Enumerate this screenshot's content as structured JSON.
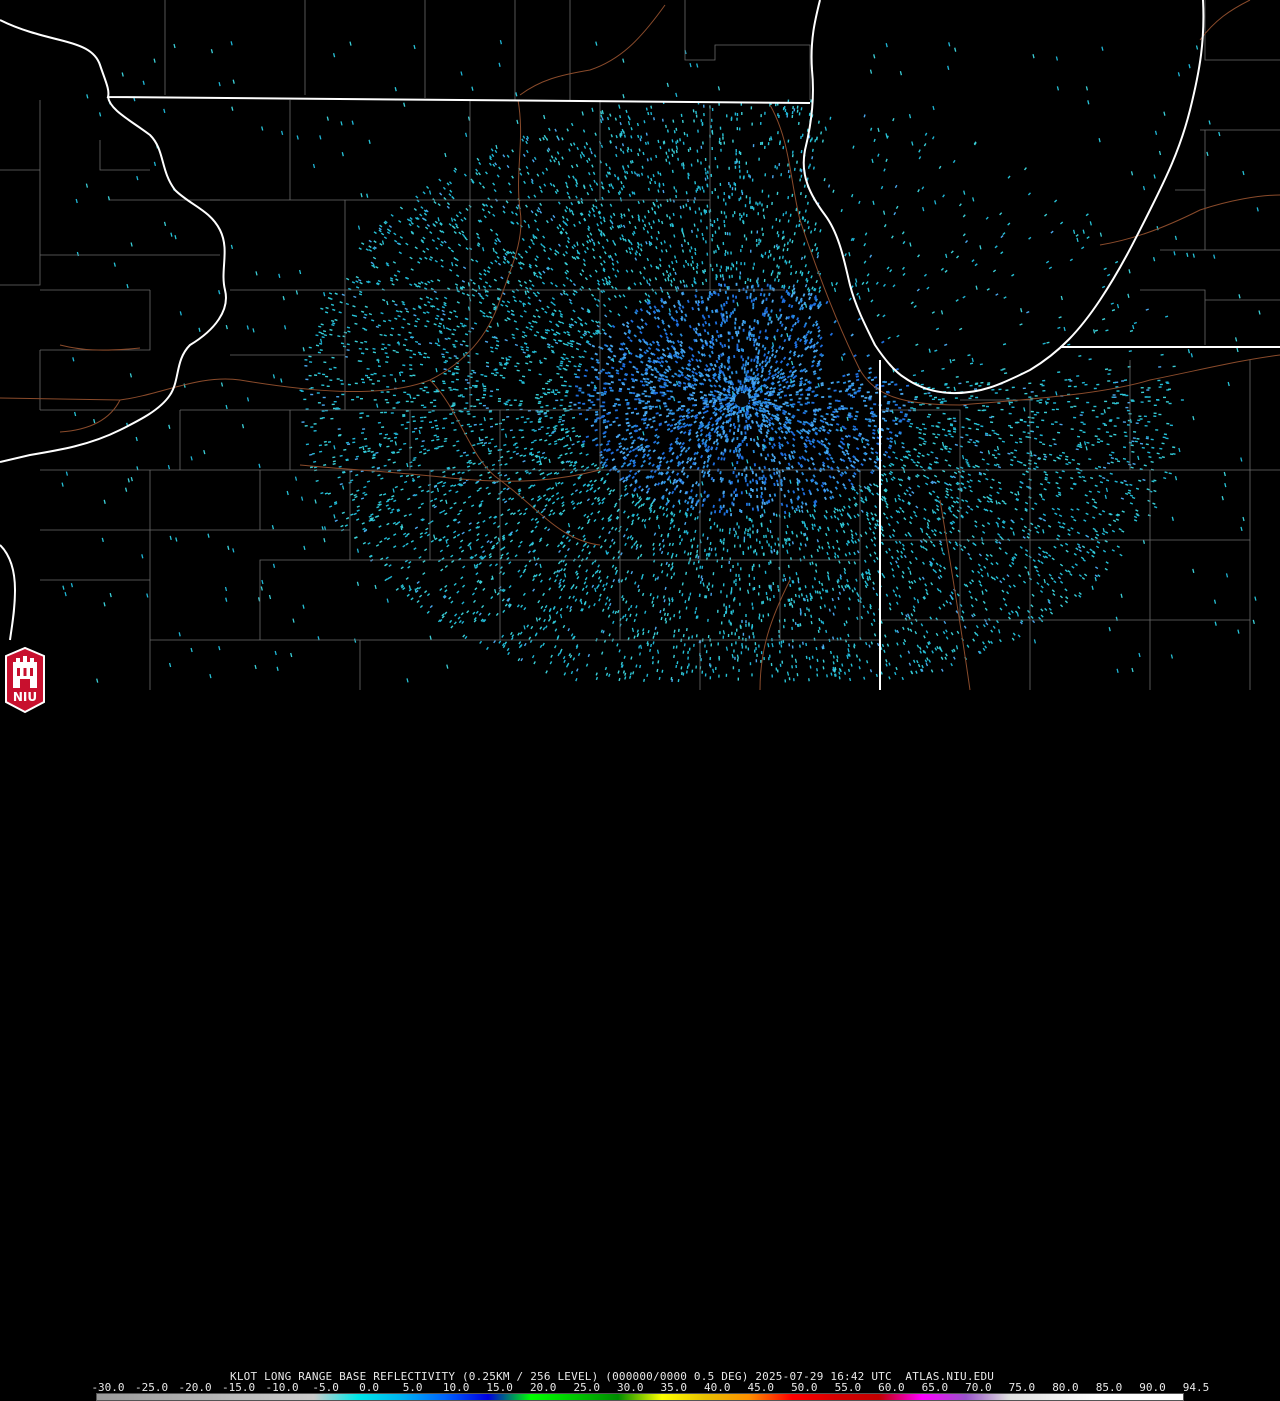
{
  "product": {
    "title": "KLOT LONG RANGE BASE REFLECTIVITY (0.25KM / 256 LEVEL) (000000/0000 0.5 DEG) 2025-07-29 16:42 UTC  ATLAS.NIU.EDU"
  },
  "logo": {
    "text": "NIU"
  },
  "scale": {
    "labels": [
      "-30.0",
      "-25.0",
      "-20.0",
      "-15.0",
      "-10.0",
      "-5.0",
      "0.0",
      "5.0",
      "10.0",
      "15.0",
      "20.0",
      "25.0",
      "30.0",
      "35.0",
      "40.0",
      "45.0",
      "50.0",
      "55.0",
      "60.0",
      "65.0",
      "70.0",
      "75.0",
      "80.0",
      "85.0",
      "90.0",
      "94.5"
    ],
    "colors": [
      "#9a9a9a",
      "#a4a4a4",
      "#aeaeae",
      "#b9b9b9",
      "#c3c3c3",
      "#cdcdcd",
      "#00e8e8",
      "#00b4f0",
      "#0064ff",
      "#0000e0",
      "#00ff00",
      "#00c800",
      "#008c00",
      "#ffff00",
      "#e7c000",
      "#ff9000",
      "#ff0000",
      "#d60000",
      "#c00000",
      "#ff00ff",
      "#9955c9",
      "#e0e0e0",
      "#f0f0f0",
      "#ffffff",
      "#ffffff"
    ]
  },
  "map": {
    "radar_site": "KLOT",
    "echo_colors": [
      "#1fb6d6",
      "#27c4d8",
      "#3bd0d8",
      "#2a90e0",
      "#4aa8ee",
      "#1e6fe0"
    ]
  }
}
